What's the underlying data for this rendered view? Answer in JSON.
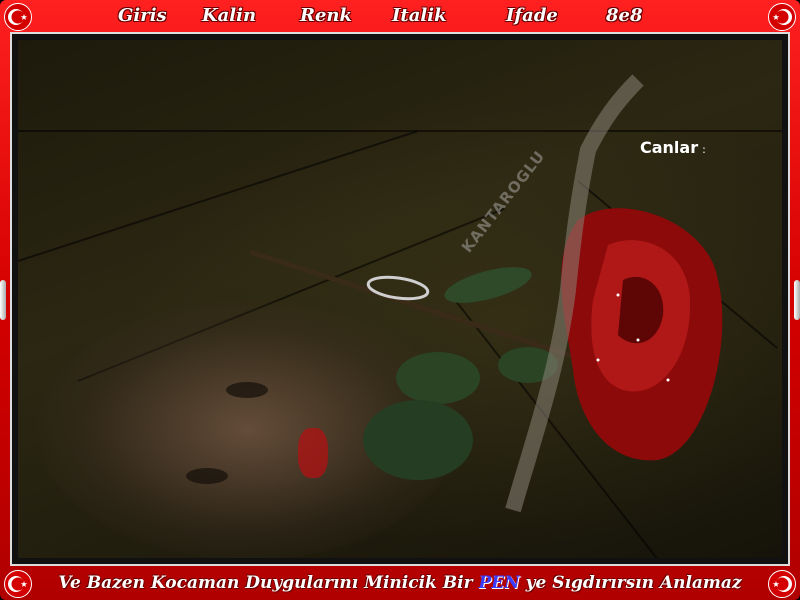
{
  "menu": {
    "items": [
      {
        "id": "giris",
        "label": "Giris"
      },
      {
        "id": "kalin",
        "label": "Kalin"
      },
      {
        "id": "renk",
        "label": "Renk"
      },
      {
        "id": "italik",
        "label": "Italik"
      },
      {
        "id": "ifade",
        "label": "Ifade"
      },
      {
        "id": "8e8",
        "label": "8e8"
      }
    ]
  },
  "photo": {
    "caption": "Canlar",
    "caption_suffix": ":",
    "watermark": "KANTAROGLU"
  },
  "footer": {
    "text_before": "Ve Bazen Kocaman Duygularını Minicik Bir",
    "highlight": "PEN",
    "text_after": "ye Sıgdırırsın Anlamaz"
  },
  "colors": {
    "frame": "#d40000",
    "highlight": "#3a3cff",
    "text": "#ffffff"
  },
  "icons": {
    "flag": "turkish-crescent-star-icon"
  }
}
